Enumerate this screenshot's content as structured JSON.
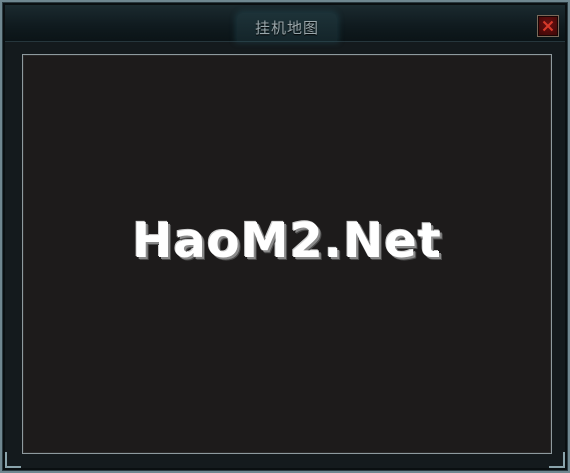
{
  "window": {
    "title": "挂机地图",
    "close_icon": "close-x-icon"
  },
  "panel": {
    "watermark": "HaoM2.Net"
  },
  "colors": {
    "frame": "#6f8790",
    "panel_bg": "#1d1b1b",
    "close_red": "#d83a2a"
  }
}
